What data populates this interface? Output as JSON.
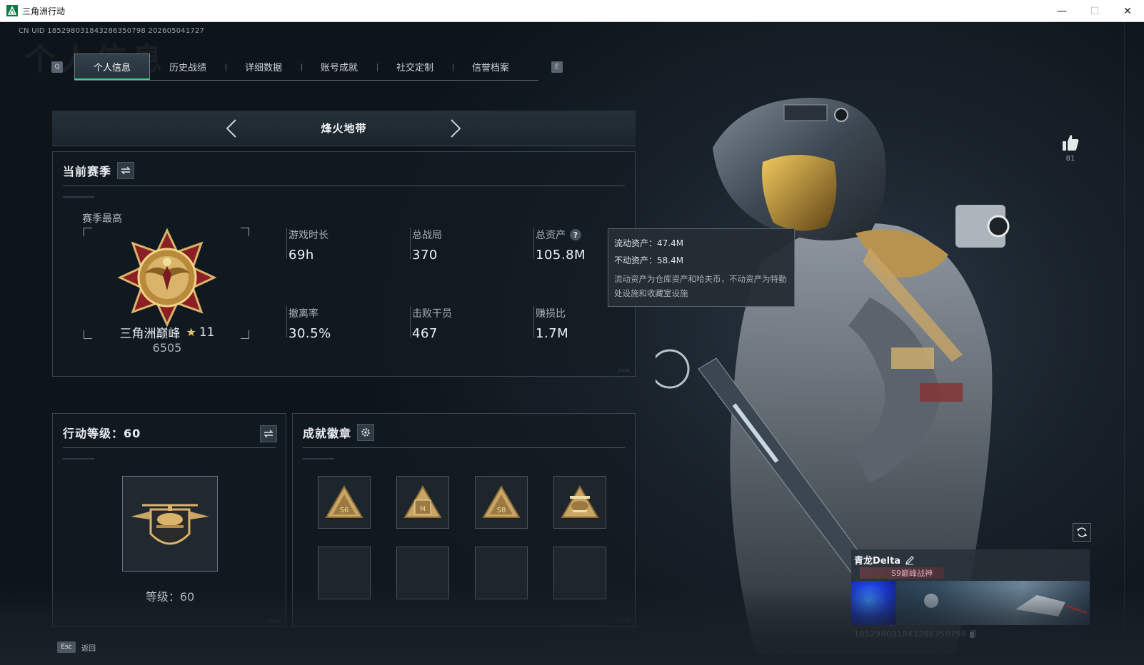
{
  "window": {
    "title": "三角洲行动",
    "controls": {
      "minimize": "—",
      "maximize": "☐",
      "close": "✕"
    }
  },
  "header": {
    "uid_line": "CN UID 18529803184328635079​8 20260504172​7",
    "watermark": "个人信息",
    "key_left": "Q",
    "key_right": "E",
    "tabs": [
      {
        "label": "个人信息",
        "active": true
      },
      {
        "label": "历史战绩",
        "active": false
      },
      {
        "label": "详细数据",
        "active": false
      },
      {
        "label": "账号成就",
        "active": false
      },
      {
        "label": "社交定制",
        "active": false
      },
      {
        "label": "信誉档案",
        "active": false
      }
    ]
  },
  "mode_selector": {
    "title": "烽火地带"
  },
  "season": {
    "title": "当前赛季",
    "best_label": "赛季最高",
    "rank_name": "三角洲巅峰",
    "rank_star_icon": "★",
    "rank_stars": "11",
    "rank_points": "6505",
    "stats": [
      {
        "label": "游戏时长",
        "value": "69h"
      },
      {
        "label": "总战局",
        "value": "370"
      },
      {
        "label": "总资产",
        "value": "105.8M",
        "help": "?"
      },
      {
        "label": "撤离率",
        "value": "30.5%"
      },
      {
        "label": "击败干员",
        "value": "467"
      },
      {
        "label": "赚损比",
        "value": "1.7M"
      }
    ],
    "corner_dots": "▫▫▫"
  },
  "tooltip": {
    "liquid": "流动资产：47.4M",
    "fixed": "不动资产：58.4M",
    "description": "流动资产为仓库资产和哈夫币，不动资产为特勤处设施和收藏室设施"
  },
  "ops": {
    "title": "行动等级：60",
    "level_label": "等级：60"
  },
  "achievements": {
    "title": "成就徽章",
    "badges": [
      "S6",
      "M",
      "S8",
      "crest"
    ]
  },
  "likes": {
    "count": "81"
  },
  "player": {
    "name": "青龙Delta",
    "title_badge": "S9巅峰战神",
    "id_text": "1852980318432863507​98"
  },
  "footer": {
    "esc_key": "Esc",
    "esc_label": "返回"
  },
  "colors": {
    "accent_green": "#38d18e",
    "gold": "#d9b46a",
    "background": "#0d141a"
  }
}
